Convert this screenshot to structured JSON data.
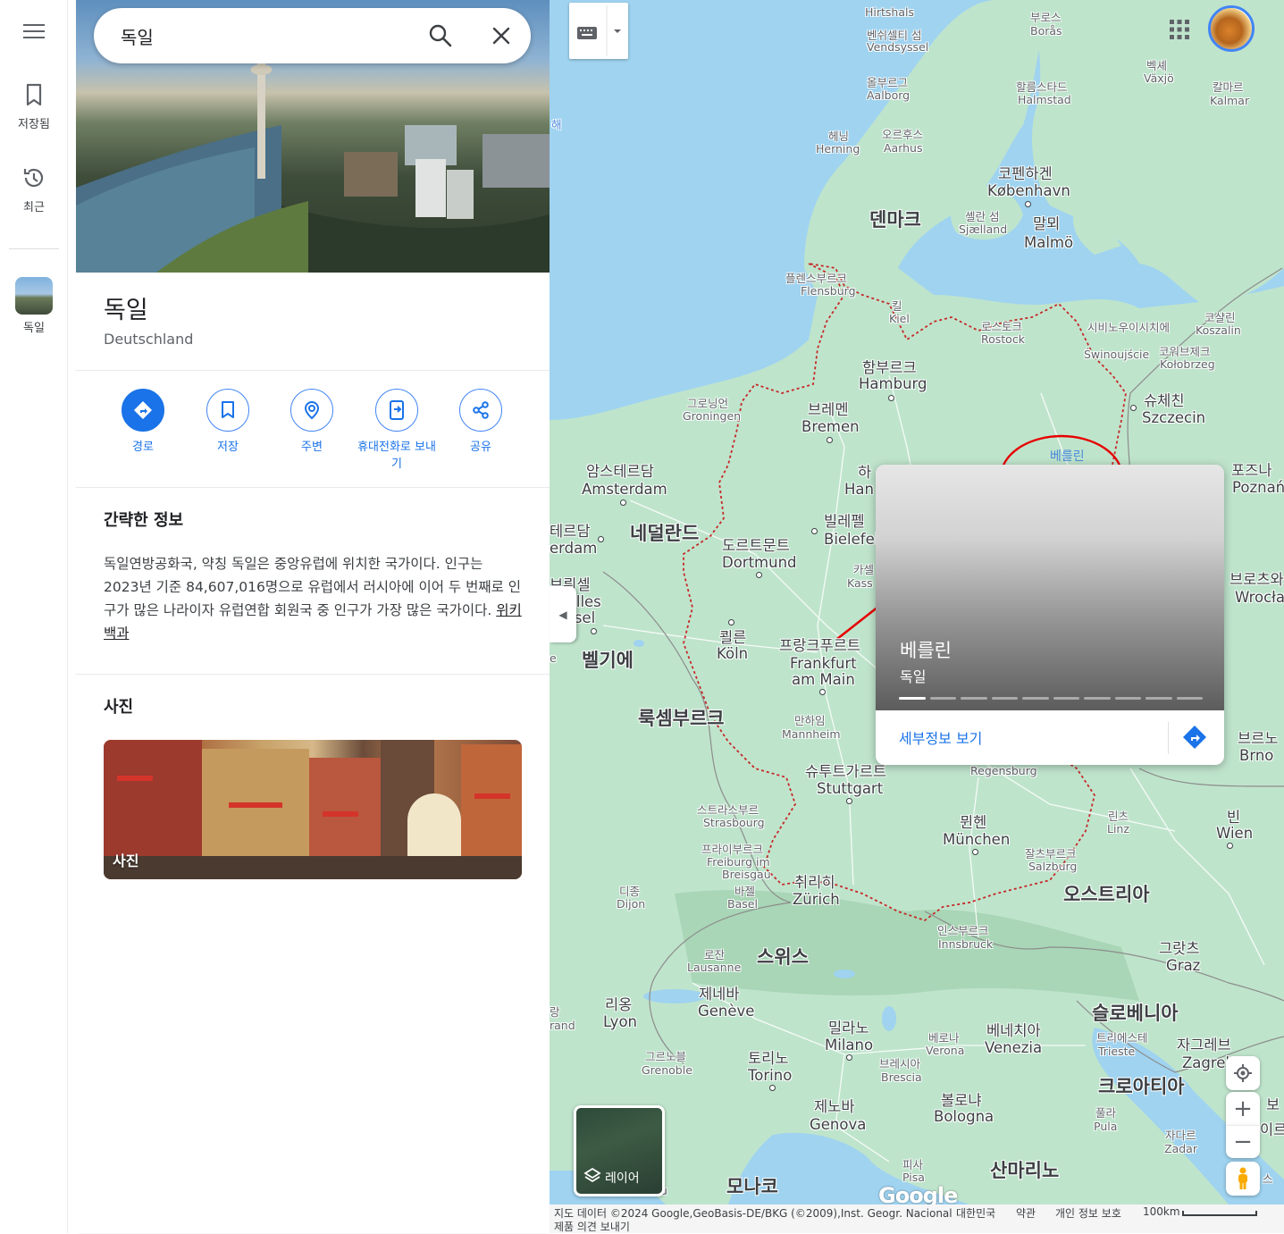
{
  "rail": {
    "saved_label": "저장됨",
    "recent_label": "최근",
    "thumb_label": "독일"
  },
  "search": {
    "value": "독일"
  },
  "place": {
    "title": "독일",
    "subtitle": "Deutschland"
  },
  "actions": [
    {
      "label": "경로",
      "icon": "directions-icon"
    },
    {
      "label": "저장",
      "icon": "bookmark-icon"
    },
    {
      "label": "주변",
      "icon": "nearby-icon"
    },
    {
      "label": "휴대전화로 보내기",
      "icon": "send-to-phone-icon"
    },
    {
      "label": "공유",
      "icon": "share-icon"
    }
  ],
  "about": {
    "title": "간략한 정보",
    "text": "독일연방공화국, 약칭 독일은 중앙유럽에 위치한 국가이다. 인구는 2023년 기준 84,607,016명으로 유럽에서 러시아에 이어 두 번째로 인구가 많은 나라이자 유럽연합 회원국 중 인구가 가장 많은 국가이다.",
    "link": "위키백과"
  },
  "photos": {
    "title": "사진",
    "card_label": "사진"
  },
  "map": {
    "labels": {
      "hirtshals": "Hirtshals",
      "vendsyssel_ko": "벤쉬셀티 섬",
      "vendsyssel": "Vendsyssel",
      "boras_ko": "부로스",
      "boras": "Borås",
      "aalborg_ko": "올부르그",
      "aalborg": "Aalborg",
      "halmstad_ko": "할름스타드",
      "halmstad": "Halmstad",
      "vaxjo_ko": "벡셰",
      "vaxjo": "Växjö",
      "kalmar_ko": "칼마르",
      "kalmar": "Kalmar",
      "herning_ko": "헤닝",
      "herning": "Herning",
      "aarhus_ko": "오르후스",
      "aarhus": "Aarhus",
      "copenhagen_ko": "코펜하겐",
      "copenhagen": "København",
      "denmark": "덴마크",
      "sjaelland_ko": "셸란 섬",
      "sjaelland": "Sjælland",
      "malmo_ko": "말뫼",
      "malmo": "Malmö",
      "flensburg_ko": "플렌스부르크",
      "flensburg": "Flensburg",
      "kiel_ko": "킬",
      "kiel": "Kiel",
      "rostock_ko": "로스토크",
      "rostock": "Rostock",
      "swinoujscie_ko": "시비노우이시치에",
      "swinoujscie": "Świnoujście",
      "koszalin_ko": "코샬린",
      "koszalin": "Koszalin",
      "kolobrzeg_ko": "코워브제크",
      "kolobrzeg": "Kołobrzeg",
      "hamburg_ko": "함부르크",
      "hamburg": "Hamburg",
      "groningen_ko": "그로닝언",
      "groningen": "Groningen",
      "bremen_ko": "브레멘",
      "bremen": "Bremen",
      "szczecin_ko": "슈체친",
      "szczecin": "Szczecin",
      "berlin_ko": "베를린",
      "amsterdam_ko": "암스테르담",
      "amsterdam": "Amsterdam",
      "hannover_ko": "하",
      "hannover": "Han",
      "poznan_ko": "포즈나",
      "poznan": "Poznań",
      "rotterdam_ko": "테르담",
      "rotterdam": "erdam",
      "netherlands": "네덜란드",
      "bielefeld_ko": "빌레펠",
      "bielefeld": "Bielefel",
      "dortmund_ko": "도르트문트",
      "dortmund": "Dortmund",
      "kassel_ko": "카셀",
      "kassel": "Kass",
      "brussels_ko": "브뤼셀",
      "brussels": "uxelles",
      "brussels2": "russel",
      "wroclaw_ko": "브로츠와",
      "wroclaw": "Wrocła",
      "koln_ko": "쾰른",
      "koln": "Köln",
      "frankfurt_ko": "프랑크푸르트",
      "frankfurt": "Frankfurt",
      "frankfurt2": "am Main",
      "belgium": "벨기에",
      "luxembourg": "룩셈부르크",
      "mannheim_ko": "만하임",
      "mannheim": "Mannheim",
      "brno_ko": "브르노",
      "brno": "Brno",
      "regensburg": "Regensburg",
      "stuttgart_ko": "슈투트가르트",
      "stuttgart": "Stuttgart",
      "strasbourg_ko": "스트라스부르",
      "strasbourg": "Strasbourg",
      "linz_ko": "린츠",
      "linz": "Linz",
      "wien_ko": "빈",
      "wien": "Wien",
      "munchen_ko": "뮌헨",
      "munchen": "München",
      "freiburg_ko": "프라이부르크",
      "freiburg": "Freiburg im",
      "freiburg2": "Breisgau",
      "salzburg_ko": "잘츠부르크",
      "salzburg": "Salzburg",
      "dijon_ko": "디종",
      "dijon": "Dijon",
      "basel_ko": "바젤",
      "basel": "Basel",
      "zurich_ko": "취리히",
      "zurich": "Zürich",
      "austria": "오스트리아",
      "innsbruck_ko": "인스부르크",
      "innsbruck": "Innsbruck",
      "lausanne_ko": "로잔",
      "lausanne": "Lausanne",
      "switzerland": "스위스",
      "graz_ko": "그랏츠",
      "graz": "Graz",
      "geneve_ko": "제네바",
      "geneve": "Genève",
      "lyon_ko": "리옹",
      "lyon": "Lyon",
      "slovenia": "슬로베니아",
      "milano_ko": "밀라노",
      "milano": "Milano",
      "verona_ko": "베로나",
      "verona": "Verona",
      "venezia_ko": "베네치아",
      "venezia": "Venezia",
      "trieste_ko": "트리에스테",
      "trieste": "Trieste",
      "zagreb_ko": "자그레브",
      "zagreb": "Zagreb",
      "grenoble_ko": "그르노블",
      "grenoble": "Grenoble",
      "torino_ko": "토리노",
      "torino": "Torino",
      "brescia_ko": "브레시아",
      "brescia": "Brescia",
      "croatia": "크로아티아",
      "genova_ko": "제노바",
      "genova": "Genova",
      "bologna_ko": "볼로냐",
      "bologna": "Bologna",
      "pula_ko": "풀라",
      "pula": "Pula",
      "zadar_ko": "자다르",
      "zadar": "Zadar",
      "pisa_ko": "피사",
      "pisa": "Pisa",
      "sanmarino": "산마리노",
      "monaco": "모나코",
      "sea_frag": "해",
      "lrand_ko": "랑",
      "lrand": "rand",
      "e_frag": "e",
      "bo_frag": "보",
      "le_frag": "르",
      "ireu_frag": "이르",
      "seu_frag": "스",
      "s_frag": "S",
      "m_frag": "u"
    }
  },
  "popup": {
    "city": "베를린",
    "country": "독일",
    "details": "세부정보 보기"
  },
  "layers": {
    "label": "레이어"
  },
  "google_logo": "Google",
  "footer": {
    "data": "지도 데이터 ©2024 Google,GeoBasis-DE/BKG (©2009),Inst. Geogr. Nacional",
    "country": "대한민국",
    "terms": "약관",
    "privacy": "개인 정보 보호",
    "scale": "100km",
    "feedback": "제품 의견 보내기"
  },
  "colors": {
    "accent": "#1a73e8",
    "water": "#9fd3f0",
    "land": "#b8e0c8",
    "border_highlight": "#c62828",
    "annotation": "#e60000"
  }
}
